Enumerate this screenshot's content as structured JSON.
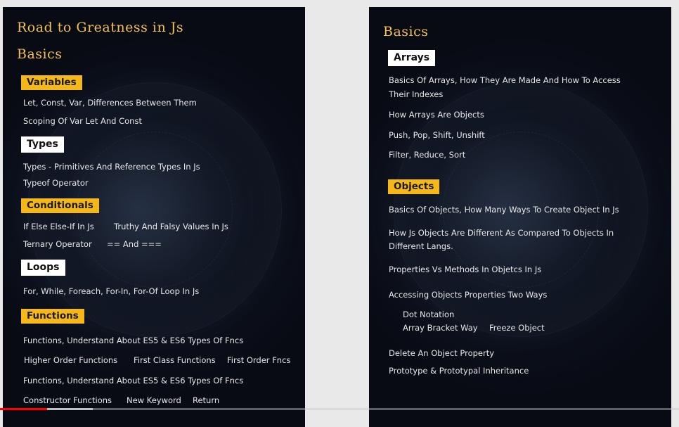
{
  "left": {
    "main_title": "Road to Greatness in Js",
    "section_title": "Basics",
    "variables": {
      "tag": "Variables",
      "items": [
        "Let, Const, Var, Differences Between Them",
        "Scoping Of Var Let And Const"
      ]
    },
    "types": {
      "tag": "Types",
      "items": [
        "Types - Primitives And Reference Types In Js",
        "Typeof Operator"
      ]
    },
    "conditionals": {
      "tag": "Conditionals",
      "items": [
        "If Else Else-If In Js",
        "Truthy And Falsy Values In Js",
        "Ternary Operator",
        "== And ==="
      ]
    },
    "loops": {
      "tag": "Loops",
      "items": [
        "For, While, Foreach, For-In, For-Of  Loop In Js"
      ]
    },
    "functions": {
      "tag": "Functions",
      "items": [
        "Functions, Understand About ES5 & ES6 Types Of Fncs",
        "Higher Order Functions",
        "First Class Functions",
        "First Order Fncs",
        "Functions, Understand About ES5 & ES6 Types Of Fncs",
        "Constructor Functions",
        "New Keyword",
        "Return"
      ]
    }
  },
  "right": {
    "section_title": "Basics",
    "arrays": {
      "tag": "Arrays",
      "items": [
        "Basics Of Arrays, How They Are Made And How To Access",
        "Their Indexes",
        "How Arrays Are Objects",
        "Push, Pop, Shift, Unshift",
        "Filter, Reduce, Sort"
      ]
    },
    "objects": {
      "tag": "Objects",
      "items": [
        "Basics Of Objects, How Many Ways To Create Object In Js",
        "How Js Objects Are Different As Compared To Objects In",
        "Different Langs.",
        "Properties Vs Methods In Objetcs In Js",
        "Accessing Objects Properties Two Ways",
        "Dot Notation",
        "Array Bracket Way",
        "Freeze Object",
        "Delete An Object Property",
        "Prototype & Prototypal Inheritance"
      ]
    }
  },
  "player": {
    "progress_fraction": 0.069,
    "buffered_fraction": 0.137,
    "played_color": "#ff0000"
  },
  "colors": {
    "accent_yellow": "#f5b818",
    "title_gold": "#f2c14e",
    "panel_bg": "#080b14"
  }
}
